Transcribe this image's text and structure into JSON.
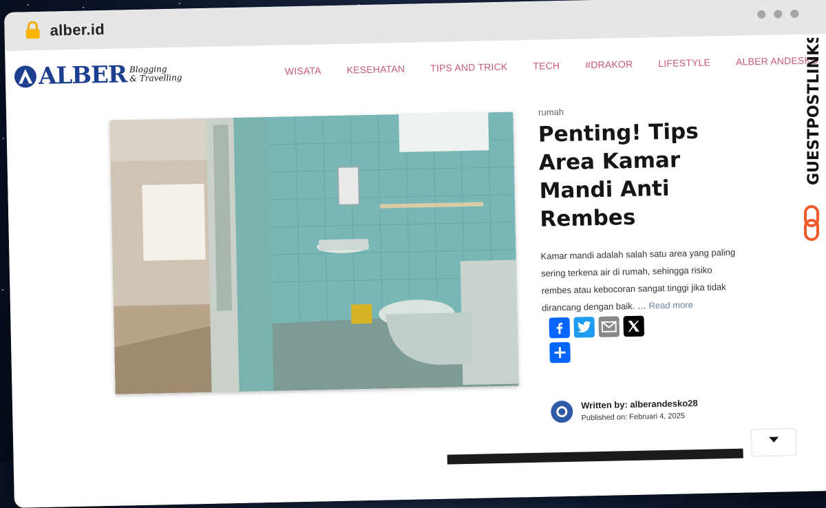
{
  "browser": {
    "url": "alber.id"
  },
  "site": {
    "logo_text": "ALBER",
    "logo_sub_line1": "Blogging",
    "logo_sub_line2": "& Travelling",
    "nav": [
      "WISATA",
      "KESEHATAN",
      "TIPS AND TRICK",
      "TECH",
      "#DRAKOR",
      "LIFESTYLE",
      "ALBER ANDESKO"
    ]
  },
  "post": {
    "category": "rumah",
    "title": "Penting! Tips Area Kamar Mandi Anti Rembes",
    "excerpt": "Kamar mandi adalah salah satu area yang paling sering terkena air di rumah, sehingga risiko rembes atau kebocoran sangat tinggi jika tidak dirancang dengan baik. …",
    "read_more": "Read more",
    "author_label": "Written by: alberandesko28",
    "published": "Published on: Februari 4, 2025"
  },
  "share_icons": [
    "facebook-icon",
    "twitter-icon",
    "email-icon",
    "x-icon",
    "share-plus-icon"
  ],
  "watermark": "GUESTPOSTLINKS",
  "colors": {
    "nav": "#c85a73",
    "brand": "#1d3f8f",
    "facebook": "#0866ff",
    "twitter": "#1d9bf0",
    "email": "#888888",
    "x": "#000000",
    "share": "#0166ff",
    "watermark_orange": "#f05a28"
  }
}
